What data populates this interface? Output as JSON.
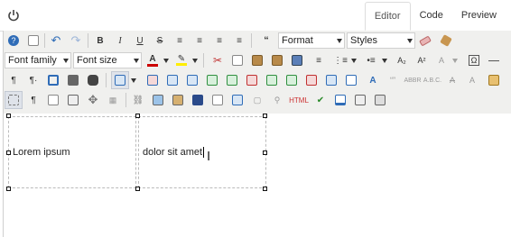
{
  "header": {
    "power_icon": "power-icon",
    "tabs": [
      {
        "label": "Editor",
        "active": true
      },
      {
        "label": "Code",
        "active": false
      },
      {
        "label": "Preview",
        "active": false
      }
    ]
  },
  "toolbar": {
    "format_select": "Format",
    "styles_select": "Styles",
    "font_family_select": "Font family",
    "font_size_select": "Font size",
    "colors": {
      "font_color": "#cc0000",
      "highlight_color": "#ffee00",
      "accent": "#2f6cb7"
    }
  },
  "content": {
    "cell_1": "Lorem ipsum",
    "cell_2": "dolor sit amet"
  }
}
